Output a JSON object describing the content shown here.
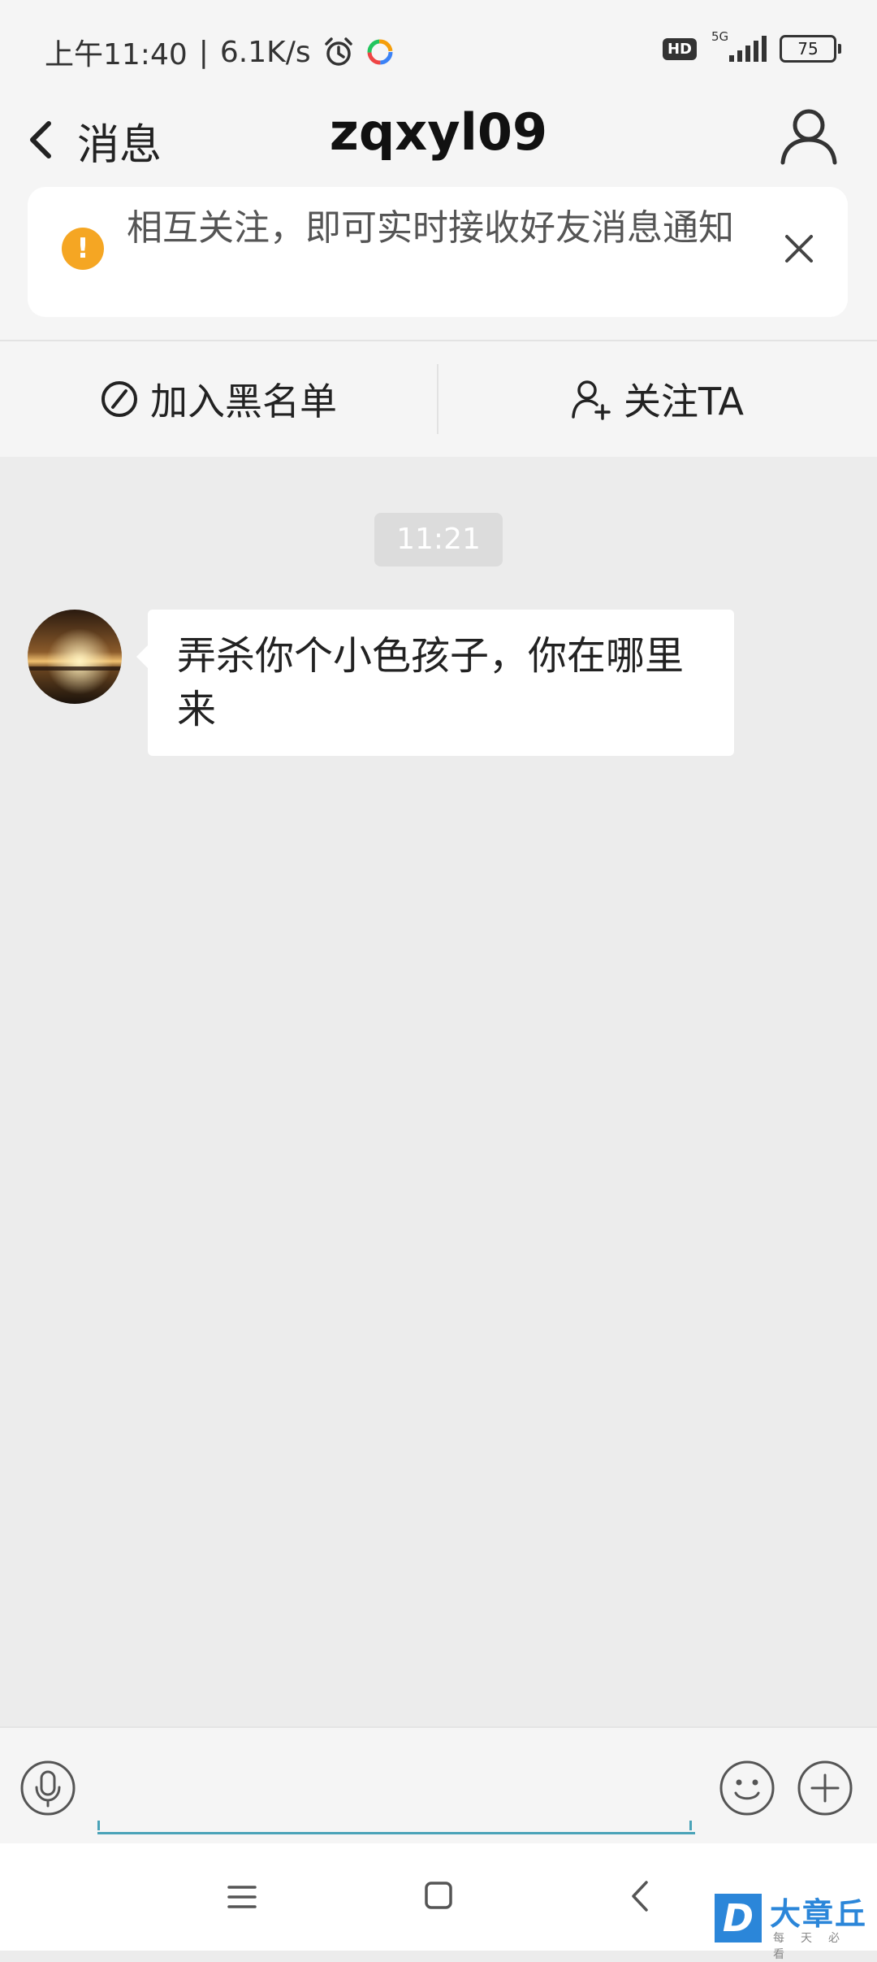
{
  "status_bar": {
    "time": "上午11:40",
    "speed": "6.1K/s",
    "hd": "HD",
    "network": "5G",
    "battery": "75"
  },
  "header": {
    "back_label": "消息",
    "title": "zqxyl09"
  },
  "notice": {
    "text": "相互关注，即可实时接收好友消息通知"
  },
  "actions": {
    "block_label": "加入黑名单",
    "follow_label": "关注TA"
  },
  "chat": {
    "timestamp": "11:21",
    "messages": [
      {
        "text": "弄杀你个小色孩子，你在哪里来"
      }
    ]
  },
  "input": {
    "value": "",
    "placeholder": ""
  },
  "watermark": {
    "logo_letter": "D",
    "title": "大章丘",
    "subtitle": "每天必看"
  },
  "colors": {
    "warning": "#f5a623",
    "input_underline": "#4aa3b8",
    "chat_background": "#ececec",
    "watermark_blue": "#2b86d9"
  }
}
